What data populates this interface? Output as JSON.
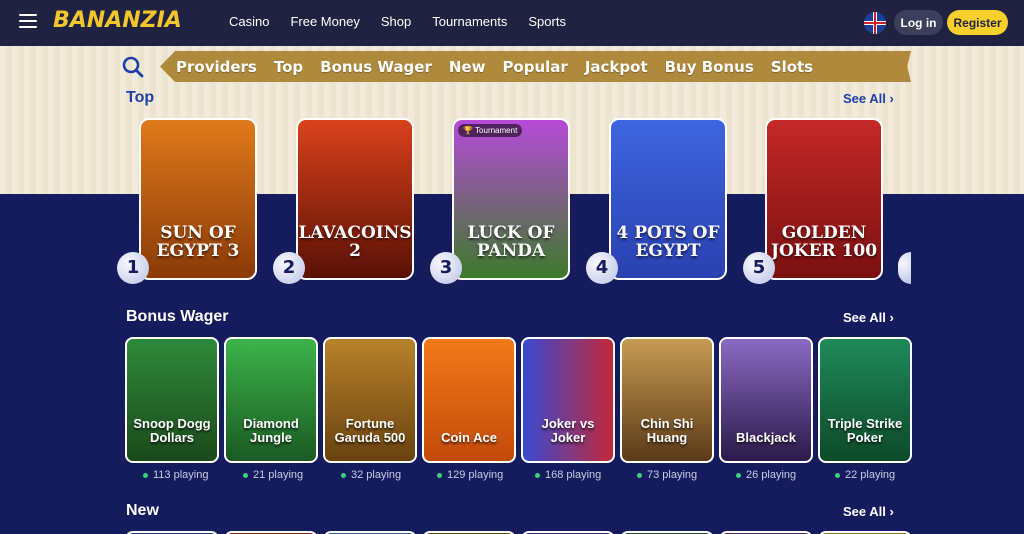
{
  "header": {
    "logo": "BANANZIA",
    "nav": [
      "Casino",
      "Free Money",
      "Shop",
      "Tournaments",
      "Sports"
    ],
    "login_label": "Log in",
    "register_label": "Register"
  },
  "categories": [
    "Providers",
    "Top",
    "Bonus Wager",
    "New",
    "Popular",
    "Jackpot",
    "Buy Bonus",
    "Slots"
  ],
  "top": {
    "title": "Top",
    "see_all": "See All",
    "games": [
      {
        "rank": "1",
        "title": "SUN OF EGYPT 3",
        "badge": ""
      },
      {
        "rank": "2",
        "title": "LAVACOINS 2",
        "badge": ""
      },
      {
        "rank": "3",
        "title": "LUCK OF PANDA",
        "badge": "Tournament"
      },
      {
        "rank": "4",
        "title": "4 POTS OF EGYPT",
        "badge": ""
      },
      {
        "rank": "5",
        "title": "GOLDEN JOKER 100",
        "badge": ""
      }
    ]
  },
  "bonus_wager": {
    "title": "Bonus Wager",
    "see_all": "See All",
    "games": [
      {
        "title": "Snoop Dogg Dollars",
        "playing": "113 playing"
      },
      {
        "title": "Diamond Jungle",
        "playing": "21 playing"
      },
      {
        "title": "Fortune Garuda 500",
        "playing": "32 playing"
      },
      {
        "title": "Coin Ace",
        "playing": "129 playing"
      },
      {
        "title": "Joker vs Joker",
        "playing": "168 playing"
      },
      {
        "title": "Chin Shi Huang",
        "playing": "73 playing"
      },
      {
        "title": "Blackjack",
        "playing": "26 playing"
      },
      {
        "title": "Triple Strike Poker",
        "playing": "22 playing"
      }
    ]
  },
  "new": {
    "title": "New",
    "see_all": "See All"
  },
  "colors": {
    "header_bg": "#1f2240",
    "accent_yellow": "#f9cf2b",
    "section_bg": "#141c5e",
    "catbar": "#b08a3c"
  }
}
